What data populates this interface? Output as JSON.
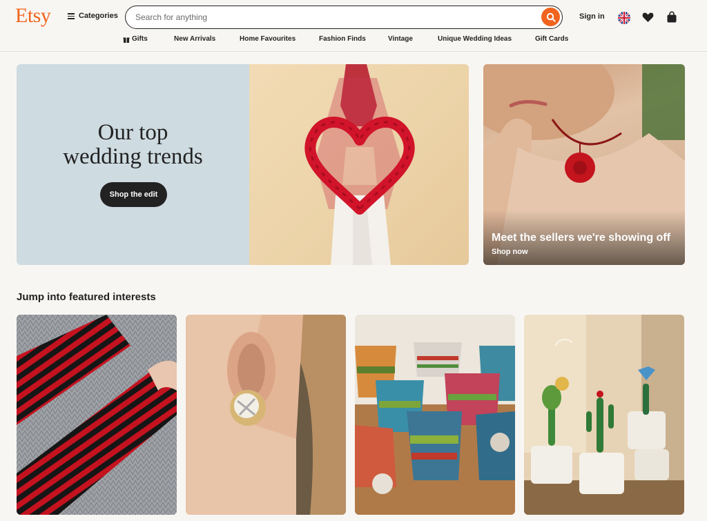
{
  "header": {
    "logo": "Etsy",
    "categories_label": "Categories",
    "search_placeholder": "Search for anything",
    "signin_label": "Sign in",
    "icons": [
      "menu-icon",
      "search-icon",
      "uk-flag-icon",
      "heart-icon",
      "shopping-bag-icon"
    ]
  },
  "nav": {
    "items": [
      {
        "label": "Gifts",
        "icon": "gift-icon"
      },
      {
        "label": "New Arrivals"
      },
      {
        "label": "Home Favourites"
      },
      {
        "label": "Fashion Finds"
      },
      {
        "label": "Vintage"
      },
      {
        "label": "Unique Wedding Ideas"
      },
      {
        "label": "Gift Cards"
      }
    ]
  },
  "hero": {
    "title_line1": "Our top",
    "title_line2": "wedding trends",
    "button_label": "Shop the edit"
  },
  "side_card": {
    "title": "Meet the sellers we're showing off",
    "link": "Shop now"
  },
  "interests": {
    "title": "Jump into featured interests",
    "tiles": [
      {
        "name": "striped-arm-warmers"
      },
      {
        "name": "crystal-earring"
      },
      {
        "name": "woven-baskets"
      },
      {
        "name": "glass-cactus-pots"
      }
    ]
  },
  "colors": {
    "brand": "#f1641e",
    "hero_bg": "#cedbe1",
    "button_dark": "#222222"
  }
}
